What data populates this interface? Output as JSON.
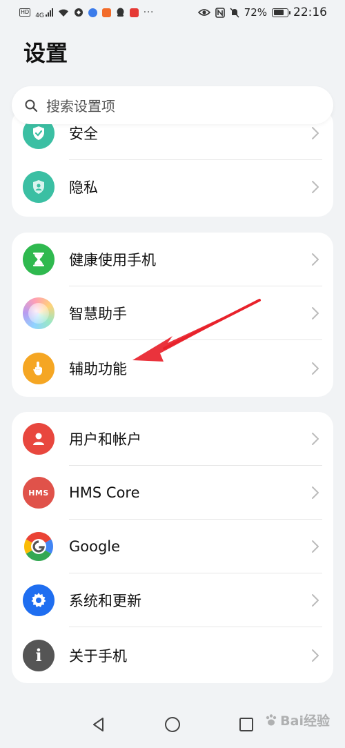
{
  "status_bar": {
    "hd": "HD",
    "network": "4G",
    "battery": "72%",
    "time": "22:16",
    "dots": "···"
  },
  "page": {
    "title": "设置"
  },
  "search": {
    "placeholder": "搜索设置项"
  },
  "groups": [
    {
      "items": [
        {
          "label": "安全",
          "icon": "shield-check-icon",
          "color": "#3bbfa3"
        },
        {
          "label": "隐私",
          "icon": "privacy-shield-icon",
          "color": "#3bbfa3"
        }
      ]
    },
    {
      "items": [
        {
          "label": "健康使用手机",
          "icon": "hourglass-icon",
          "color": "#2fb94f"
        },
        {
          "label": "智慧助手",
          "icon": "smart-assistant-icon",
          "color": "#b89cf0"
        },
        {
          "label": "辅助功能",
          "icon": "hand-pointer-icon",
          "color": "#f5a623"
        }
      ]
    },
    {
      "items": [
        {
          "label": "用户和帐户",
          "icon": "user-icon",
          "color": "#e8473e"
        },
        {
          "label": "HMS Core",
          "icon": "hms-icon",
          "color": "#e0524a",
          "badge": "HMS"
        },
        {
          "label": "Google",
          "icon": "google-icon",
          "color": "#ffffff"
        },
        {
          "label": "系统和更新",
          "icon": "gear-icon",
          "color": "#1f6ef0"
        },
        {
          "label": "关于手机",
          "icon": "info-icon",
          "color": "#555555",
          "badge": "i"
        }
      ]
    }
  ],
  "watermark": {
    "text": "Bai经验"
  }
}
